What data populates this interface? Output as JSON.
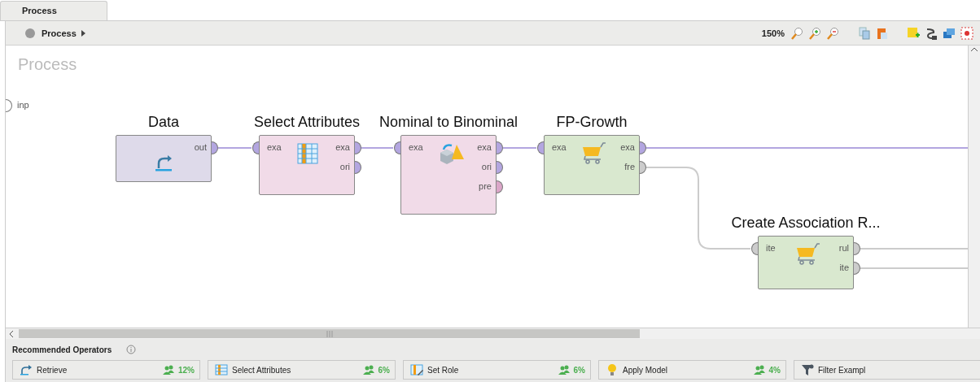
{
  "tab": {
    "label": "Process",
    "selected": true
  },
  "breadcrumb": {
    "label": "Process"
  },
  "zoom": "150%",
  "canvas": {
    "title": "Process",
    "input_port": "inp",
    "nodes": [
      {
        "title": "Data",
        "kind": "retrieve",
        "color": "#dedaea",
        "outputs": [
          {
            "label": "out",
            "color": "#b3a6e0"
          }
        ]
      },
      {
        "title": "Select Attributes",
        "kind": "select",
        "color": "#f1dbe8",
        "inputs": [
          {
            "label": "exa",
            "color": "#b3a6e0"
          }
        ],
        "outputs": [
          {
            "label": "exa",
            "color": "#b3a6e0"
          },
          {
            "label": "ori",
            "color": "#b3a6e0"
          }
        ]
      },
      {
        "title": "Nominal to Binominal",
        "kind": "convert",
        "color": "#f1dbe8",
        "inputs": [
          {
            "label": "exa",
            "color": "#b3a6e0"
          }
        ],
        "outputs": [
          {
            "label": "exa",
            "color": "#b3a6e0"
          },
          {
            "label": "ori",
            "color": "#b3a6e0"
          },
          {
            "label": "pre",
            "color": "#dba6c8"
          }
        ]
      },
      {
        "title": "FP-Growth",
        "kind": "cart",
        "color": "#d9e8cf",
        "inputs": [
          {
            "label": "exa",
            "color": "#b3a6e0"
          }
        ],
        "outputs": [
          {
            "label": "exa",
            "color": "#b3a6e0"
          },
          {
            "label": "fre",
            "color": "#cccccc"
          }
        ]
      },
      {
        "title": "Create Association R...",
        "kind": "cart",
        "color": "#d9e8cf",
        "inputs": [
          {
            "label": "ite",
            "color": "#cccccc"
          }
        ],
        "outputs": [
          {
            "label": "rul",
            "color": "#cccccc"
          },
          {
            "label": "ite",
            "color": "#cccccc"
          }
        ]
      }
    ]
  },
  "recommended": {
    "title": "Recommended Operators",
    "items": [
      {
        "name": "Retrieve",
        "kind": "retrieve",
        "share": "12%"
      },
      {
        "name": "Select Attributes",
        "kind": "table",
        "share": "6%"
      },
      {
        "name": "Set Role",
        "kind": "role",
        "share": "6%"
      },
      {
        "name": "Apply Model",
        "kind": "bulb",
        "share": "4%"
      },
      {
        "name": "Filter Exampl",
        "kind": "funnel"
      }
    ]
  }
}
